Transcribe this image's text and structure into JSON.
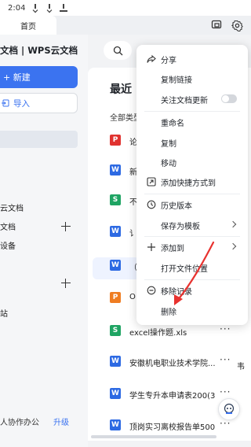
{
  "status_bar": {
    "time": "2:04"
  },
  "tabs": {
    "home_label": "首页"
  },
  "sidebar": {
    "brand": "文档 | WPS云文档",
    "new_button": "+ 新建",
    "import_button": "导入",
    "items": [
      {
        "label": "云文档"
      },
      {
        "label": "文档"
      },
      {
        "label": "设备"
      },
      {
        "label": "站"
      }
    ],
    "footer_text": "人协作办公",
    "upgrade": "升级"
  },
  "main": {
    "title": "最近",
    "filter": "全部类型",
    "files": [
      {
        "type": "pdf",
        "icon": "P",
        "name": "论"
      },
      {
        "type": "w",
        "icon": "W",
        "name": "新"
      },
      {
        "type": "s",
        "icon": "S",
        "name": "不"
      },
      {
        "type": "w",
        "icon": "W",
        "name": "讠"
      },
      {
        "type": "w",
        "icon": "W",
        "name": "（"
      },
      {
        "type": "p",
        "icon": "P",
        "name": "O"
      },
      {
        "type": "s",
        "icon": "S",
        "name": "excel操作题.xls"
      },
      {
        "type": "w",
        "icon": "W",
        "name": "安徽机电职业技术学院..."
      },
      {
        "type": "w",
        "icon": "W",
        "name": "学生专升本申请表200(3)"
      },
      {
        "type": "w",
        "icon": "W",
        "name": "顶岗实习离校报告单500("
      }
    ],
    "row_overflow_text": "韦"
  },
  "context_menu": {
    "items": [
      {
        "label": "分享",
        "icon": "share-icon"
      },
      {
        "label": "复制链接",
        "icon": ""
      },
      {
        "label": "关注文档更新",
        "icon": "",
        "toggle": false
      },
      {
        "label": "重命名",
        "icon": ""
      },
      {
        "label": "复制",
        "icon": ""
      },
      {
        "label": "移动",
        "icon": ""
      },
      {
        "label": "添加快捷方式到",
        "icon": "shortcut-icon"
      },
      {
        "label": "历史版本",
        "icon": "history-icon"
      },
      {
        "label": "保存为模板",
        "icon": "",
        "submenu": true
      },
      {
        "label": "添加到",
        "icon": "plus-icon",
        "submenu": true
      },
      {
        "label": "打开文件位置",
        "icon": ""
      },
      {
        "label": "移除记录",
        "icon": "remove-circle-icon"
      },
      {
        "label": "删除",
        "icon": ""
      }
    ]
  },
  "colors": {
    "accent": "#3b73f0",
    "annotation": "#e8322f"
  }
}
